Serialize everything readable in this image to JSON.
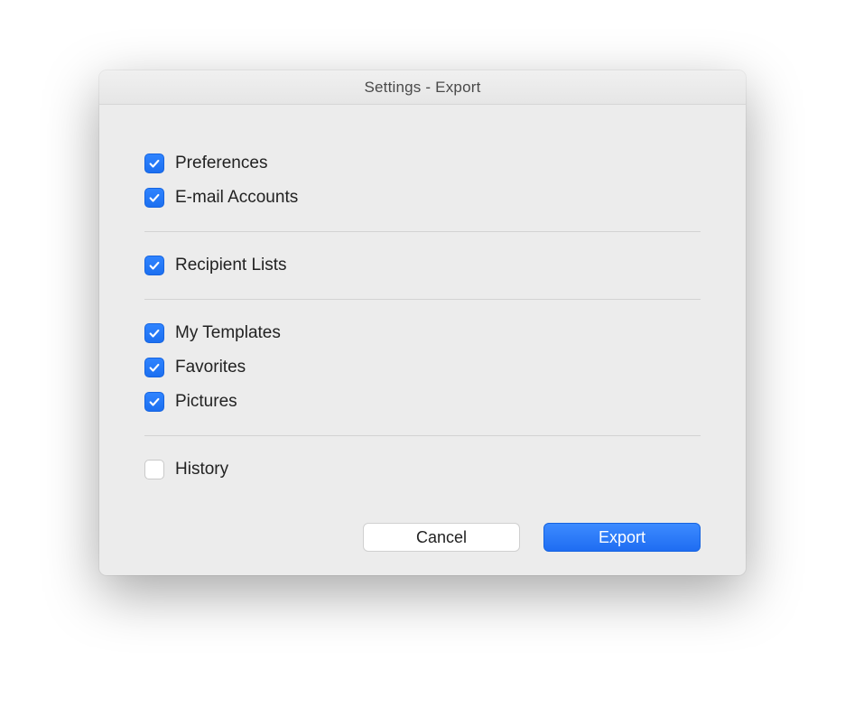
{
  "dialog": {
    "title": "Settings - Export"
  },
  "groups": [
    [
      {
        "id": "preferences",
        "label": "Preferences",
        "checked": true
      },
      {
        "id": "email-accounts",
        "label": "E-mail Accounts",
        "checked": true
      }
    ],
    [
      {
        "id": "recipient-lists",
        "label": "Recipient Lists",
        "checked": true
      }
    ],
    [
      {
        "id": "my-templates",
        "label": "My Templates",
        "checked": true
      },
      {
        "id": "favorites",
        "label": "Favorites",
        "checked": true
      },
      {
        "id": "pictures",
        "label": "Pictures",
        "checked": true
      }
    ],
    [
      {
        "id": "history",
        "label": "History",
        "checked": false
      }
    ]
  ],
  "buttons": {
    "cancel": "Cancel",
    "export": "Export"
  }
}
